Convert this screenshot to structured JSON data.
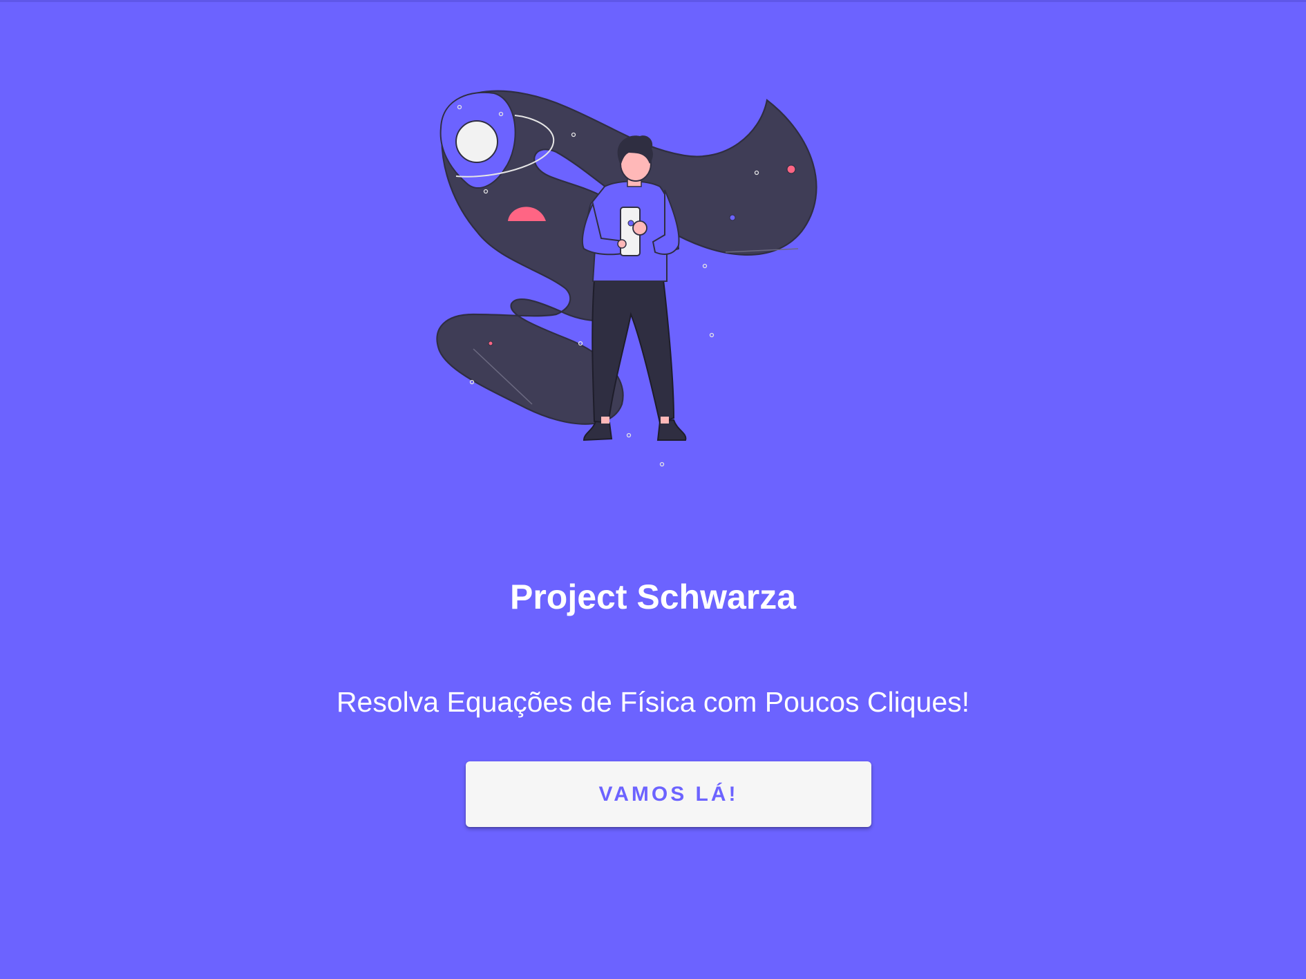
{
  "hero": {
    "title": "Project Schwarza",
    "subtitle": "Resolva Equações de Física com Poucos Cliques!",
    "cta_label": "VAMOS LÁ!"
  },
  "illustration": {
    "icon": "person-with-phone-in-space-illustration"
  },
  "colors": {
    "background": "#6c63ff",
    "space_ribbon": "#3f3d56",
    "accent_red": "#ff6584",
    "button_bg": "#f6f6f6",
    "button_text": "#6c63ff",
    "outline": "#2f2e41",
    "skin": "#ffb8b8"
  }
}
